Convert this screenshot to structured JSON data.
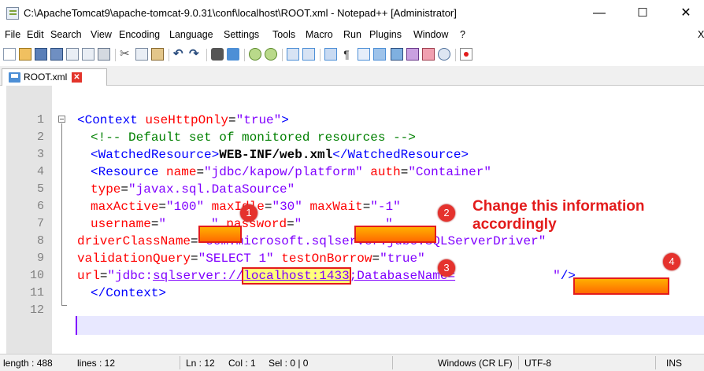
{
  "window": {
    "title": "C:\\ApacheTomcat9\\apache-tomcat-9.0.31\\conf\\localhost\\ROOT.xml - Notepad++ [Administrator]",
    "minimize": "—",
    "maximize": "☐",
    "close": "✕"
  },
  "menu": [
    "File",
    "Edit",
    "Search",
    "View",
    "Encoding",
    "Language",
    "Settings",
    "Tools",
    "Macro",
    "Run",
    "Plugins",
    "Window",
    "?",
    "X"
  ],
  "tab": {
    "label": "ROOT.xml",
    "close": "✕"
  },
  "lines": [
    "1",
    "2",
    "3",
    "4",
    "5",
    "6",
    "7",
    "8",
    "9",
    "10",
    "11",
    "12"
  ],
  "code": {
    "l1": {
      "open": "<Context",
      "attr": " useHttpOnly",
      "eq": "=",
      "val": "\"true\"",
      "close": ">"
    },
    "l2": {
      "comment": "<!-- Default set of monitored resources -->"
    },
    "l3": {
      "open": "<WatchedResource",
      "close": ">",
      "text": "WEB-INF/web.xml",
      "end": "</WatchedResource>"
    },
    "l4": {
      "open": "<Resource",
      "a1": " name",
      "v1": "\"jdbc/kapow/platform\"",
      "a2": " auth",
      "v2": "\"Container\""
    },
    "l5": {
      "a1": "type",
      "v1": "\"javax.sql.DataSource\""
    },
    "l6": {
      "a1": "maxActive",
      "v1": "\"100\"",
      "a2": " maxIdle",
      "v2": "\"30\"",
      "a3": " maxWait",
      "v3": "\"-1\""
    },
    "l7": {
      "a1": "username",
      "v1a": "\"",
      "v1b": "\"",
      "a2": " password",
      "v2a": "\"",
      "v2b": "\""
    },
    "l8": {
      "a1": "driverClassName",
      "v1": "\"com.microsoft.sqlserver.jdbc.SQLServerDriver\""
    },
    "l9": {
      "a1": "validationQuery",
      "v1": "\"SELECT 1\"",
      "a2": " testOnBorrow",
      "v2": "\"true\""
    },
    "l10": {
      "a1": "url",
      "v_pre": "\"jdbc:",
      "v_u1": "sqlserver://",
      "v_host": "localhost:1433",
      "v_mid": ";DatabaseName=",
      "v_end": "\"",
      "close": "/>"
    },
    "l11": {
      "end": "</Context>"
    }
  },
  "annotation": {
    "text1": "Change this information",
    "text2": "accordingly"
  },
  "badges": [
    "1",
    "2",
    "3",
    "4"
  ],
  "status": {
    "length": "length : 488",
    "lines": "lines : 12",
    "ln": "Ln : 12",
    "col": "Col : 1",
    "sel": "Sel : 0 | 0",
    "eol": "Windows (CR LF)",
    "enc": "UTF-8",
    "mode": "INS"
  },
  "colors": {
    "tag": "#0000ff",
    "attr": "#ff0000",
    "value": "#8000ff",
    "comment": "#008000",
    "annotation": "#e31b1b"
  }
}
